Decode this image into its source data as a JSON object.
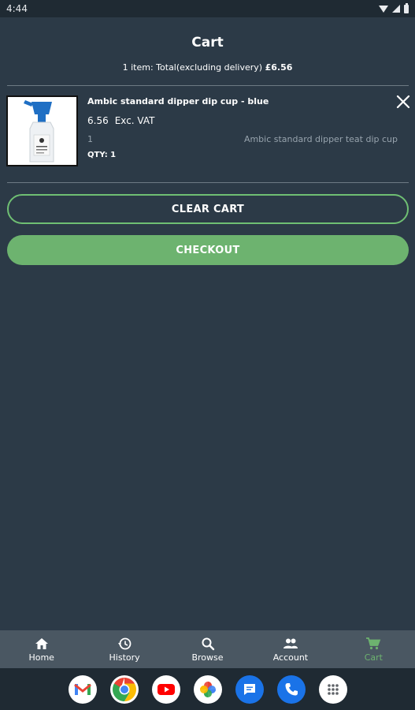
{
  "status_bar": {
    "time": "4:44"
  },
  "page": {
    "title": "Cart"
  },
  "summary": {
    "prefix": "1 item: Total(excluding delivery) ",
    "amount": "£6.56"
  },
  "cart_items": [
    {
      "name": "Ambic standard dipper dip cup - blue",
      "price": "6.56",
      "vat_label": "Exc. VAT",
      "quantity_value": "1",
      "description": "Ambic standard dipper teat dip cup",
      "qty_label": "QTY: 1",
      "thumbnail_icon": "dip-cup-bottle"
    }
  ],
  "buttons": {
    "clear": "CLEAR CART",
    "checkout": "CHECKOUT"
  },
  "bottom_nav": [
    {
      "label": "Home",
      "icon": "home-icon"
    },
    {
      "label": "History",
      "icon": "history-icon"
    },
    {
      "label": "Browse",
      "icon": "search-icon"
    },
    {
      "label": "Account",
      "icon": "people-icon"
    },
    {
      "label": "Cart",
      "icon": "cart-icon",
      "active": true
    }
  ],
  "dock_apps": [
    "gmail",
    "chrome",
    "youtube",
    "photos",
    "messages",
    "phone",
    "app-drawer"
  ],
  "colors": {
    "background": "#2c3a47",
    "accent": "#6db36f",
    "nav": "#4a5762"
  }
}
